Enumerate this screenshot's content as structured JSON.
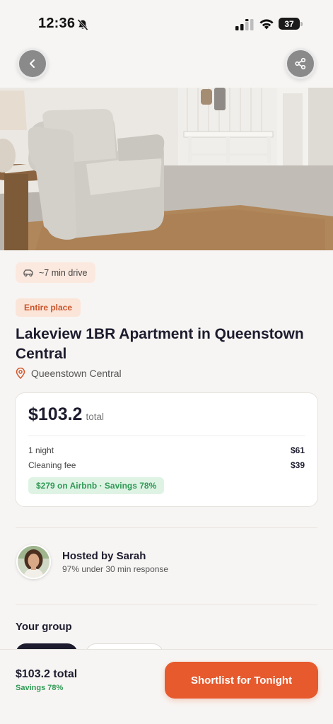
{
  "status_bar": {
    "time": "12:36",
    "battery": "37"
  },
  "top_buttons": {
    "back_icon": "chevron-left-icon",
    "share_icon": "share-icon"
  },
  "photo": {
    "page_indicator": {
      "count": 3,
      "active_index": 0
    }
  },
  "drive_chip": {
    "icon": "car-icon",
    "text": "~7 min drive"
  },
  "listing": {
    "type_badge": "Entire place",
    "title": "Lakeview 1BR Apartment in Queenstown Central",
    "location_icon": "map-pin-icon",
    "location": "Queenstown Central"
  },
  "price_card": {
    "amount": "$103.2",
    "total_label": "total",
    "lines": [
      {
        "label": "1 night",
        "value": "$61"
      },
      {
        "label": "Cleaning fee",
        "value": "$39"
      }
    ],
    "savings_badge": "$279 on Airbnb · Savings 78%"
  },
  "host": {
    "name": "Hosted by Sarah",
    "response": "97% under 30 min response"
  },
  "group": {
    "title": "Your group"
  },
  "bottom_bar": {
    "total": "$103.2 total",
    "savings": "Savings 78%",
    "cta_label": "Shortlist for Tonight"
  },
  "colors": {
    "accent": "#e65a2e",
    "savings_green": "#2f9a55",
    "badge_orange": "#c9542a",
    "background": "#f7f5f3"
  }
}
